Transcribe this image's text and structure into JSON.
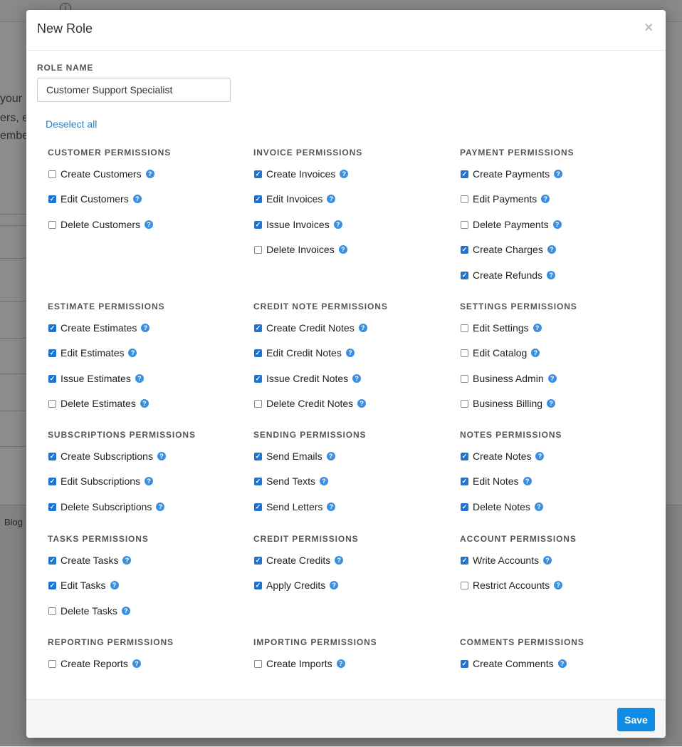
{
  "background": {
    "lines": [
      "your",
      "ers, e",
      "embe"
    ],
    "footer_link": "Blog",
    "info_icon": "info-circle-icon"
  },
  "modal": {
    "title": "New Role",
    "close_icon": "close-icon",
    "role_name_label": "ROLE NAME",
    "role_name_value": "Customer Support Specialist",
    "deselect_all": "Deselect all",
    "save_label": "Save",
    "accent_color": "#0e8ce6",
    "help_icon": "question-circle-icon"
  },
  "groups": [
    {
      "title": "CUSTOMER PERMISSIONS",
      "items": [
        {
          "label": "Create Customers",
          "checked": false
        },
        {
          "label": "Edit Customers",
          "checked": true
        },
        {
          "label": "Delete Customers",
          "checked": false
        }
      ]
    },
    {
      "title": "INVOICE PERMISSIONS",
      "items": [
        {
          "label": "Create Invoices",
          "checked": true
        },
        {
          "label": "Edit Invoices",
          "checked": true
        },
        {
          "label": "Issue Invoices",
          "checked": true
        },
        {
          "label": "Delete Invoices",
          "checked": false
        }
      ]
    },
    {
      "title": "PAYMENT PERMISSIONS",
      "items": [
        {
          "label": "Create Payments",
          "checked": true
        },
        {
          "label": "Edit Payments",
          "checked": false
        },
        {
          "label": "Delete Payments",
          "checked": false
        },
        {
          "label": "Create Charges",
          "checked": true
        },
        {
          "label": "Create Refunds",
          "checked": true
        }
      ]
    },
    {
      "title": "ESTIMATE PERMISSIONS",
      "items": [
        {
          "label": "Create Estimates",
          "checked": true
        },
        {
          "label": "Edit Estimates",
          "checked": true
        },
        {
          "label": "Issue Estimates",
          "checked": true
        },
        {
          "label": "Delete Estimates",
          "checked": false
        }
      ]
    },
    {
      "title": "CREDIT NOTE PERMISSIONS",
      "items": [
        {
          "label": "Create Credit Notes",
          "checked": true
        },
        {
          "label": "Edit Credit Notes",
          "checked": true
        },
        {
          "label": "Issue Credit Notes",
          "checked": true
        },
        {
          "label": "Delete Credit Notes",
          "checked": false
        }
      ]
    },
    {
      "title": "SETTINGS PERMISSIONS",
      "items": [
        {
          "label": "Edit Settings",
          "checked": false
        },
        {
          "label": "Edit Catalog",
          "checked": false
        },
        {
          "label": "Business Admin",
          "checked": false
        },
        {
          "label": "Business Billing",
          "checked": false
        }
      ]
    },
    {
      "title": "SUBSCRIPTIONS PERMISSIONS",
      "items": [
        {
          "label": "Create Subscriptions",
          "checked": true
        },
        {
          "label": "Edit Subscriptions",
          "checked": true
        },
        {
          "label": "Delete Subscriptions",
          "checked": true
        }
      ]
    },
    {
      "title": "SENDING PERMISSIONS",
      "items": [
        {
          "label": "Send Emails",
          "checked": true
        },
        {
          "label": "Send Texts",
          "checked": true
        },
        {
          "label": "Send Letters",
          "checked": true
        }
      ]
    },
    {
      "title": "NOTES PERMISSIONS",
      "items": [
        {
          "label": "Create Notes",
          "checked": true
        },
        {
          "label": "Edit Notes",
          "checked": true
        },
        {
          "label": "Delete Notes",
          "checked": true
        }
      ]
    },
    {
      "title": "TASKS PERMISSIONS",
      "items": [
        {
          "label": "Create Tasks",
          "checked": true
        },
        {
          "label": "Edit Tasks",
          "checked": true
        },
        {
          "label": "Delete Tasks",
          "checked": false
        }
      ]
    },
    {
      "title": "CREDIT PERMISSIONS",
      "items": [
        {
          "label": "Create Credits",
          "checked": true
        },
        {
          "label": "Apply Credits",
          "checked": true
        }
      ]
    },
    {
      "title": "ACCOUNT PERMISSIONS",
      "items": [
        {
          "label": "Write Accounts",
          "checked": true
        },
        {
          "label": "Restrict Accounts",
          "checked": false
        }
      ]
    },
    {
      "title": "REPORTING PERMISSIONS",
      "items": [
        {
          "label": "Create Reports",
          "checked": false
        }
      ]
    },
    {
      "title": "IMPORTING PERMISSIONS",
      "items": [
        {
          "label": "Create Imports",
          "checked": false
        }
      ]
    },
    {
      "title": "COMMENTS PERMISSIONS",
      "items": [
        {
          "label": "Create Comments",
          "checked": true
        }
      ]
    }
  ]
}
